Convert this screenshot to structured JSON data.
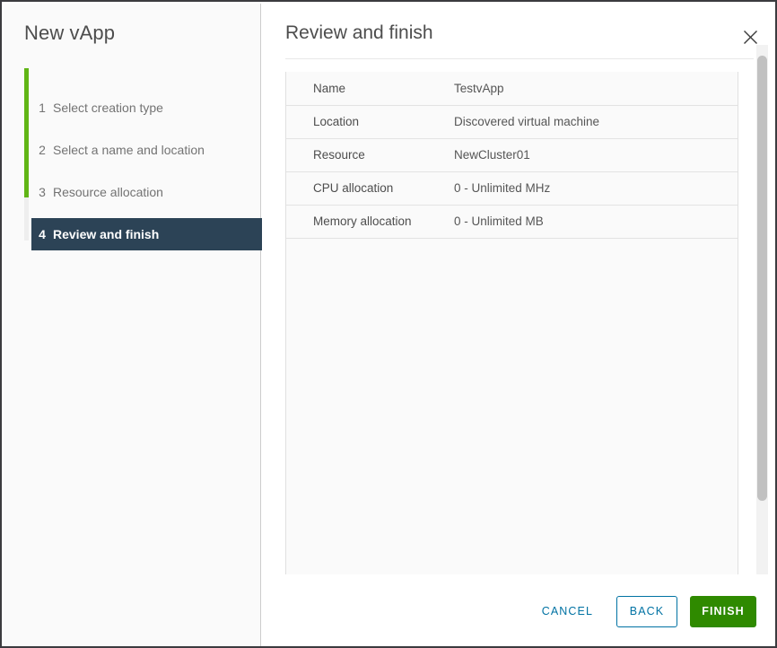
{
  "window": {
    "accent_green": "#60b515",
    "accent_blue": "#0072a3",
    "active_step_bg": "#2c4356",
    "finish_green": "#2f8a00"
  },
  "sidebar": {
    "title": "New vApp",
    "steps": [
      {
        "num": "1",
        "label": "Select creation type",
        "active": false
      },
      {
        "num": "2",
        "label": "Select a name and location",
        "active": false
      },
      {
        "num": "3",
        "label": "Resource allocation",
        "active": false
      },
      {
        "num": "4",
        "label": "Review and finish",
        "active": true
      }
    ]
  },
  "panel": {
    "title": "Review and finish",
    "close_label": "close-icon"
  },
  "summary": {
    "rows": [
      {
        "key": "Name",
        "value": "TestvApp"
      },
      {
        "key": "Location",
        "value": "Discovered virtual machine"
      },
      {
        "key": "Resource",
        "value": "NewCluster01"
      },
      {
        "key": "CPU allocation",
        "value": "0 - Unlimited MHz"
      },
      {
        "key": "Memory allocation",
        "value": "0 - Unlimited MB"
      }
    ]
  },
  "footer": {
    "cancel_label": "CANCEL",
    "back_label": "BACK",
    "finish_label": "FINISH"
  }
}
